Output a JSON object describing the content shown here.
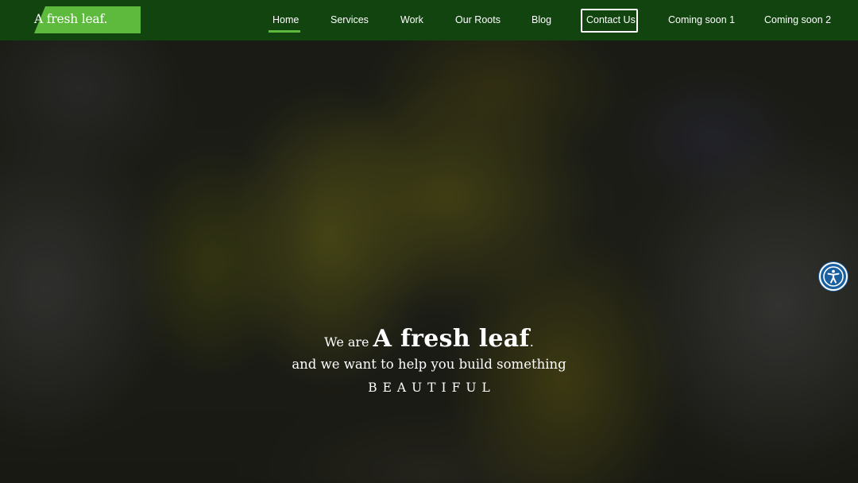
{
  "header": {
    "logo_text": "A fresh leaf.",
    "nav": [
      {
        "label": "Home",
        "active": true
      },
      {
        "label": "Services"
      },
      {
        "label": "Work"
      },
      {
        "label": "Our Roots"
      },
      {
        "label": "Blog"
      },
      {
        "label": "Contact Us",
        "highlighted": true
      },
      {
        "label": "Coming soon 1"
      },
      {
        "label": "Coming soon 2"
      }
    ]
  },
  "hero": {
    "prefix": "We are",
    "brand": "A fresh leaf",
    "brand_suffix": ".",
    "subtitle": "and we want to help you build something",
    "tagline": "BEAUTIFUL"
  },
  "accessibility": {
    "icon": "accessibility-icon"
  },
  "colors": {
    "header_bg": "#124410",
    "accent_green": "#5dba3c",
    "accessibility_blue": "#1a5fa0"
  }
}
